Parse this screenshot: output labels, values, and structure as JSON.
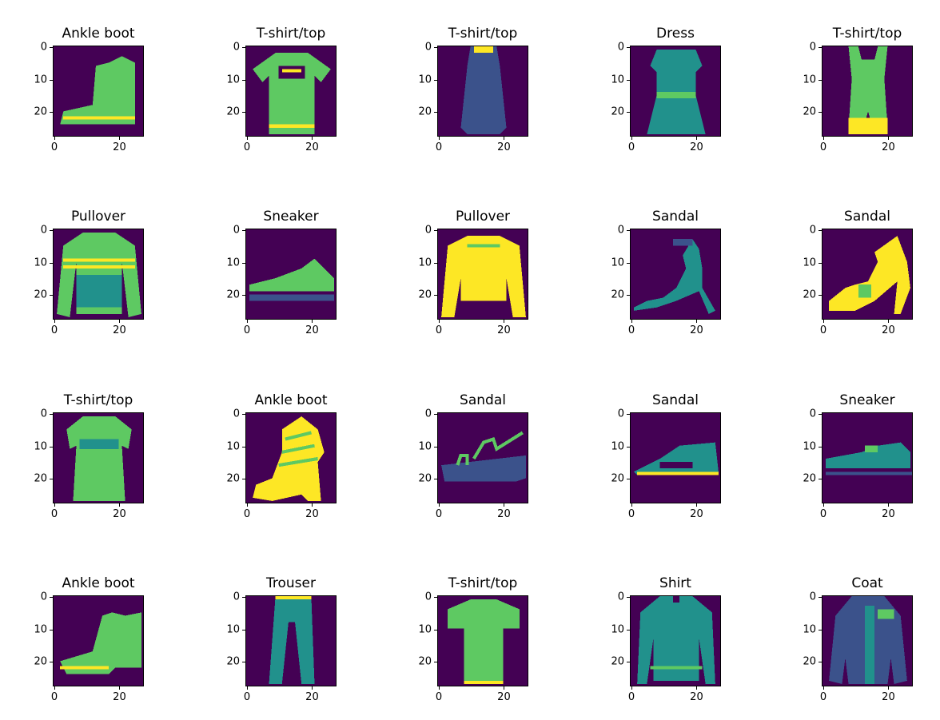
{
  "figure": {
    "background": "#ffffff",
    "colormap": [
      "#440154",
      "#3b528b",
      "#21918c",
      "#5ec962",
      "#fde725"
    ],
    "axes": {
      "xticks": [
        0,
        20
      ],
      "yticks": [
        0,
        10,
        20
      ],
      "image_rows": 28,
      "image_cols": 28
    },
    "panels": [
      {
        "title": "Ankle boot",
        "item": "ankle-boot"
      },
      {
        "title": "T-shirt/top",
        "item": "tshirt"
      },
      {
        "title": "T-shirt/top",
        "item": "tank-top"
      },
      {
        "title": "Dress",
        "item": "dress"
      },
      {
        "title": "T-shirt/top",
        "item": "romper"
      },
      {
        "title": "Pullover",
        "item": "pullover-striped"
      },
      {
        "title": "Sneaker",
        "item": "sneaker"
      },
      {
        "title": "Pullover",
        "item": "pullover"
      },
      {
        "title": "Sandal",
        "item": "sandal-heel"
      },
      {
        "title": "Sandal",
        "item": "sandal-heel-2"
      },
      {
        "title": "T-shirt/top",
        "item": "tshirt-dress"
      },
      {
        "title": "Ankle boot",
        "item": "high-boot"
      },
      {
        "title": "Sandal",
        "item": "sandal-wedge"
      },
      {
        "title": "Sandal",
        "item": "sandal-flat"
      },
      {
        "title": "Sneaker",
        "item": "sneaker-low"
      },
      {
        "title": "Ankle boot",
        "item": "ankle-boot-2"
      },
      {
        "title": "Trouser",
        "item": "trouser"
      },
      {
        "title": "T-shirt/top",
        "item": "tshirt-2"
      },
      {
        "title": "Shirt",
        "item": "shirt"
      },
      {
        "title": "Coat",
        "item": "coat"
      }
    ]
  }
}
